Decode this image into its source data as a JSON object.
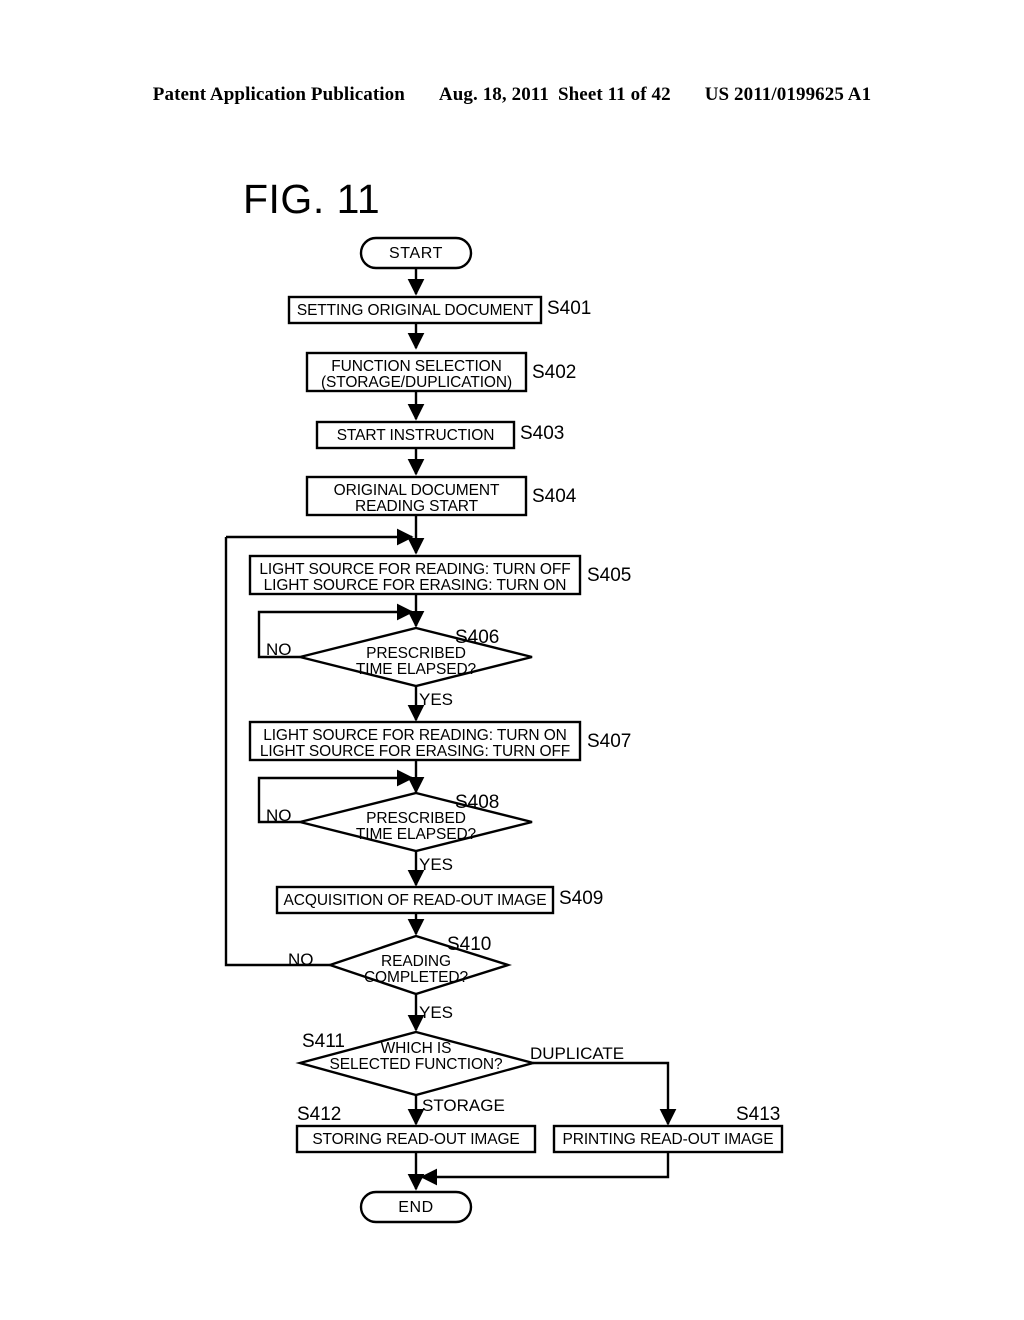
{
  "header": {
    "publication": "Patent Application Publication",
    "date": "Aug. 18, 2011",
    "sheet": "Sheet 11 of 42",
    "number": "US 2011/0199625 A1"
  },
  "figure": {
    "title": "FIG. 11"
  },
  "flow": {
    "nodes": [
      {
        "id": "start",
        "type": "terminator",
        "label": "START",
        "step": ""
      },
      {
        "id": "s401",
        "type": "process",
        "label": "SETTING ORIGINAL DOCUMENT",
        "step": "S401"
      },
      {
        "id": "s402",
        "type": "process",
        "label": "FUNCTION SELECTION",
        "label2": "(STORAGE/DUPLICATION)",
        "step": "S402"
      },
      {
        "id": "s403",
        "type": "process",
        "label": "START INSTRUCTION",
        "step": "S403"
      },
      {
        "id": "s404",
        "type": "process",
        "label": "ORIGINAL DOCUMENT",
        "label2": "READING START",
        "step": "S404"
      },
      {
        "id": "s405",
        "type": "process",
        "label": "LIGHT SOURCE FOR READING: TURN OFF",
        "label2": "LIGHT SOURCE FOR ERASING: TURN ON",
        "step": "S405"
      },
      {
        "id": "s406",
        "type": "decision",
        "label": "PRESCRIBED",
        "label2": "TIME ELAPSED?",
        "step": "S406"
      },
      {
        "id": "s407",
        "type": "process",
        "label": "LIGHT SOURCE FOR READING: TURN ON",
        "label2": "LIGHT SOURCE FOR ERASING: TURN OFF",
        "step": "S407"
      },
      {
        "id": "s408",
        "type": "decision",
        "label": "PRESCRIBED",
        "label2": "TIME ELAPSED?",
        "step": "S408"
      },
      {
        "id": "s409",
        "type": "process",
        "label": "ACQUISITION OF READ-OUT IMAGE",
        "step": "S409"
      },
      {
        "id": "s410",
        "type": "decision",
        "label": "READING",
        "label2": "COMPLETED?",
        "step": "S410"
      },
      {
        "id": "s411",
        "type": "decision",
        "label": "WHICH IS",
        "label2": "SELECTED FUNCTION?",
        "step": "S411"
      },
      {
        "id": "s412",
        "type": "process",
        "label": "STORING READ-OUT IMAGE",
        "step": "S412"
      },
      {
        "id": "s413",
        "type": "process",
        "label": "PRINTING READ-OUT IMAGE",
        "step": "S413"
      },
      {
        "id": "end",
        "type": "terminator",
        "label": "END",
        "step": ""
      }
    ],
    "edge_labels": {
      "s406_no": "NO",
      "s406_yes": "YES",
      "s408_no": "NO",
      "s408_yes": "YES",
      "s410_no": "NO",
      "s410_yes": "YES",
      "s411_storage": "STORAGE",
      "s411_duplicate": "DUPLICATE"
    }
  },
  "colors": {
    "ink": "#000000",
    "paper": "#ffffff"
  }
}
